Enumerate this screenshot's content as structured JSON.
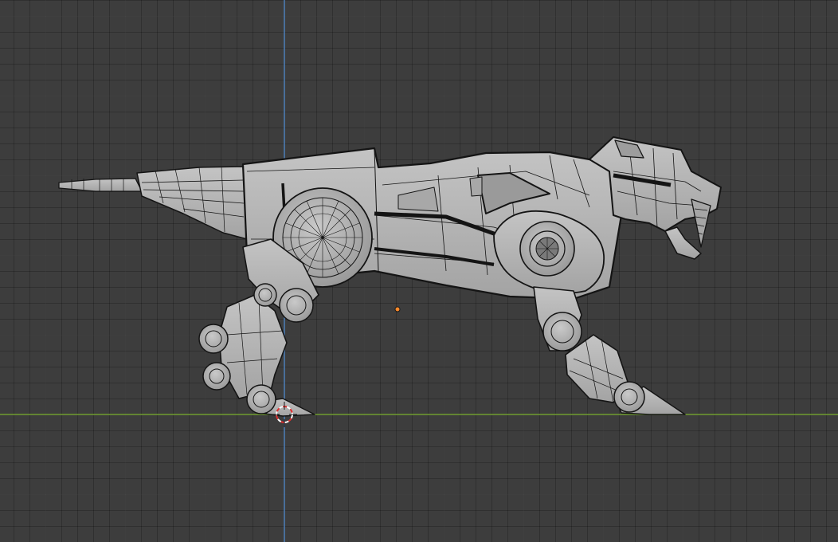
{
  "viewport": {
    "name": "3d-viewport",
    "view": "side-orthographic",
    "background_color": "#3d3d3d",
    "grid_color": "#474747",
    "x_axis_color": "#6f9b2e",
    "z_axis_color": "#4d7fb8"
  },
  "scene": {
    "object": "robot-sabertooth-lion-mesh",
    "display": "wireframe-over-solid",
    "mesh_color": "#b8b8b8",
    "wire_color": "#141414",
    "origin_marker_color": "#ff8a2a",
    "cursor_colors": [
      "#e03030",
      "#ffffff"
    ]
  }
}
